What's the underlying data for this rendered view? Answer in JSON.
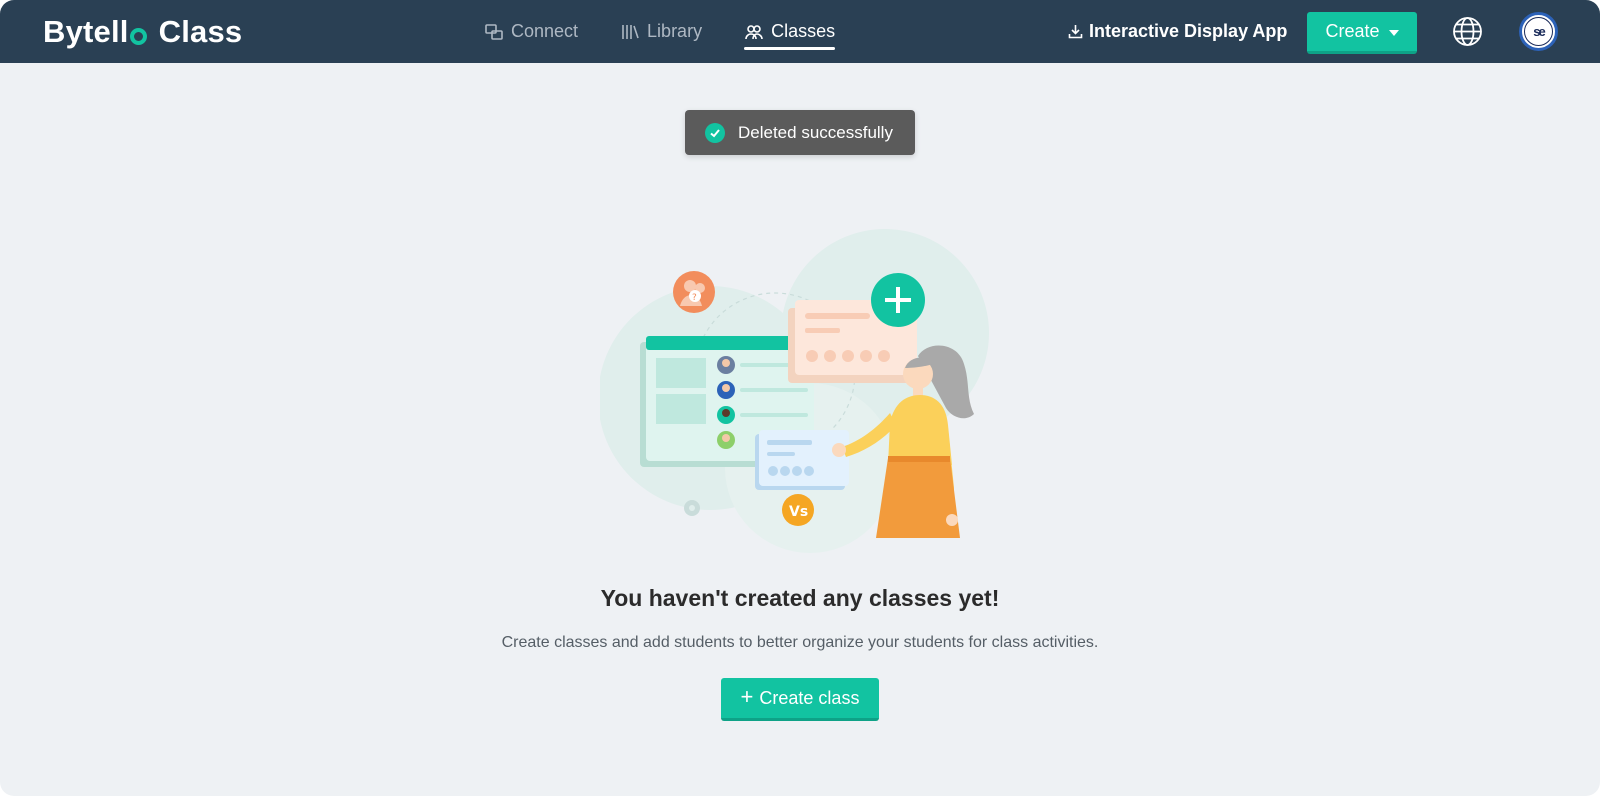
{
  "header": {
    "logo_word1": "Bytell",
    "logo_word2": "Class",
    "nav": [
      {
        "label": "Connect",
        "icon": "connect-icon",
        "active": false
      },
      {
        "label": "Library",
        "icon": "library-icon",
        "active": false
      },
      {
        "label": "Classes",
        "icon": "classes-icon",
        "active": true
      }
    ],
    "download_label": "Interactive Display App",
    "create_label": "Create",
    "avatar_text": "se"
  },
  "toast": {
    "message": "Deleted successfully"
  },
  "empty_state": {
    "title": "You haven't created any classes yet!",
    "description": "Create classes and add students to better organize your students for class activities.",
    "button_label": "Create class",
    "button_plus": "+"
  },
  "colors": {
    "header_bg": "#2a4054",
    "accent": "#12c3a1",
    "page_bg": "#eef1f4",
    "toast_bg": "#5b5b5b"
  }
}
